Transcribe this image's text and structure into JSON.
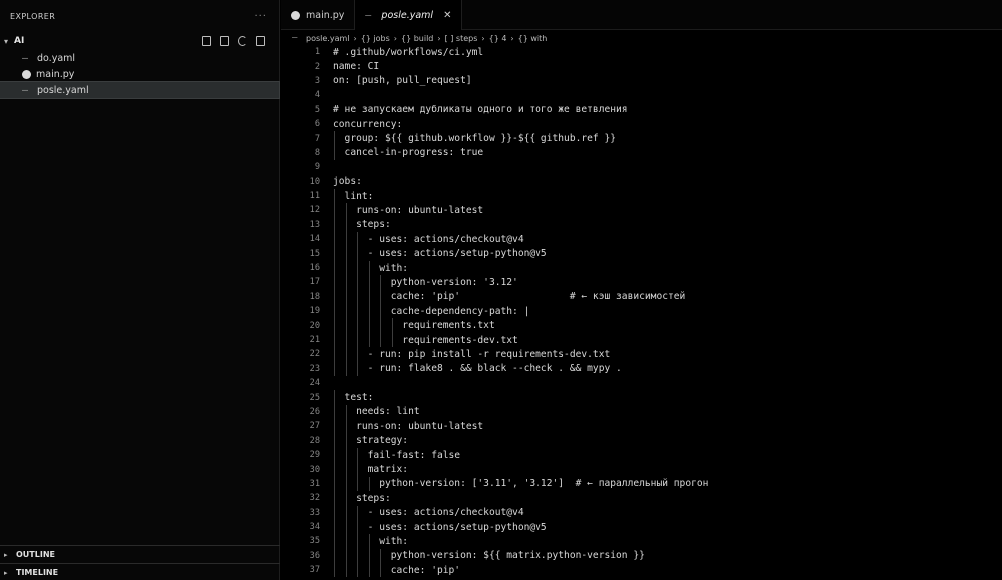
{
  "sidebar": {
    "header": "EXPLORER",
    "more": "···",
    "folder": "AI",
    "files": [
      {
        "name": "do.yaml",
        "type": "yaml"
      },
      {
        "name": "main.py",
        "type": "python"
      },
      {
        "name": "posle.yaml",
        "type": "yaml",
        "active": true
      }
    ],
    "outline": "OUTLINE",
    "timeline": "TIMELINE"
  },
  "tabs": [
    {
      "label": "main.py",
      "type": "python",
      "active": false
    },
    {
      "label": "posle.yaml",
      "type": "yaml",
      "active": true
    }
  ],
  "breadcrumb": [
    "posle.yaml",
    "{} jobs",
    "{} build",
    "[ ] steps",
    "{} 4",
    "{} with"
  ],
  "code_lines": [
    {
      "n": "1",
      "text": "# .github/workflows/ci.yml"
    },
    {
      "n": "2",
      "text": "name: CI"
    },
    {
      "n": "3",
      "text": "on: [push, pull_request]"
    },
    {
      "n": "4",
      "text": ""
    },
    {
      "n": "5",
      "text": "# не запускаем дубликаты одного и того же ветвления"
    },
    {
      "n": "6",
      "text": "concurrency:"
    },
    {
      "n": "7",
      "text": "  group: ${{ github.workflow }}-${{ github.ref }}"
    },
    {
      "n": "8",
      "text": "  cancel-in-progress: true"
    },
    {
      "n": "9",
      "text": ""
    },
    {
      "n": "10",
      "text": "jobs:"
    },
    {
      "n": "11",
      "text": "  lint:"
    },
    {
      "n": "12",
      "text": "    runs-on: ubuntu-latest"
    },
    {
      "n": "13",
      "text": "    steps:"
    },
    {
      "n": "14",
      "text": "      - uses: actions/checkout@v4"
    },
    {
      "n": "15",
      "text": "      - uses: actions/setup-python@v5"
    },
    {
      "n": "16",
      "text": "        with:"
    },
    {
      "n": "17",
      "text": "          python-version: '3.12'"
    },
    {
      "n": "18",
      "text": "          cache: 'pip'                   # ← кэш зависимостей"
    },
    {
      "n": "19",
      "text": "          cache-dependency-path: |"
    },
    {
      "n": "20",
      "text": "            requirements.txt"
    },
    {
      "n": "21",
      "text": "            requirements-dev.txt"
    },
    {
      "n": "22",
      "text": "      - run: pip install -r requirements-dev.txt"
    },
    {
      "n": "23",
      "text": "      - run: flake8 . && black --check . && mypy ."
    },
    {
      "n": "24",
      "text": ""
    },
    {
      "n": "25",
      "text": "  test:"
    },
    {
      "n": "26",
      "text": "    needs: lint"
    },
    {
      "n": "27",
      "text": "    runs-on: ubuntu-latest"
    },
    {
      "n": "28",
      "text": "    strategy:"
    },
    {
      "n": "29",
      "text": "      fail-fast: false"
    },
    {
      "n": "30",
      "text": "      matrix:"
    },
    {
      "n": "31",
      "text": "        python-version: ['3.11', '3.12']  # ← параллельный прогон"
    },
    {
      "n": "32",
      "text": "    steps:"
    },
    {
      "n": "33",
      "text": "      - uses: actions/checkout@v4"
    },
    {
      "n": "34",
      "text": "      - uses: actions/setup-python@v5"
    },
    {
      "n": "35",
      "text": "        with:"
    },
    {
      "n": "36",
      "text": "          python-version: ${{ matrix.python-version }}"
    },
    {
      "n": "37",
      "text": "          cache: 'pip'"
    }
  ]
}
